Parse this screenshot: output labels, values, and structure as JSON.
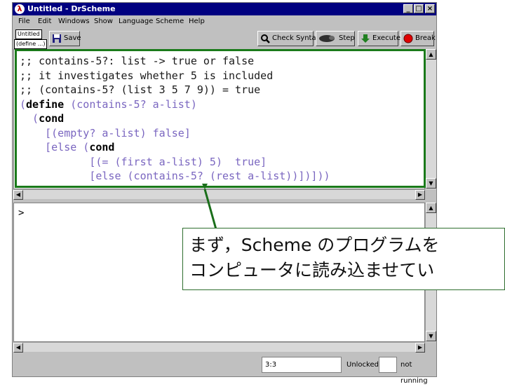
{
  "window": {
    "title": "Untitled - DrScheme",
    "app_icon": "λ",
    "controls": [
      "_",
      "□",
      "×"
    ]
  },
  "menu": {
    "items": [
      "File",
      "Edit",
      "Windows",
      "Show",
      "Language",
      "Scheme",
      "Help"
    ]
  },
  "toolbar": {
    "file_button": "Untitled",
    "define_button": "(define ...)",
    "save_label": "Save",
    "check_syntax_label": "Check Syntax",
    "step_label": "Step",
    "execute_label": "Execute",
    "break_label": "Break"
  },
  "editor": {
    "lines": [
      [
        {
          "t": ";; contains-5?: list -> true or false",
          "c": "comment"
        }
      ],
      [
        {
          "t": ";; it investigates whether 5 is included",
          "c": "comment"
        }
      ],
      [
        {
          "t": ";; (contains-5? (list 3 5 7 9)) = true",
          "c": "comment"
        }
      ],
      [
        {
          "t": "(",
          "c": "def"
        },
        {
          "t": "define",
          "c": "kw"
        },
        {
          "t": " (contains-5? a-list)",
          "c": "def"
        }
      ],
      [
        {
          "t": "  (",
          "c": "def"
        },
        {
          "t": "cond",
          "c": "kw"
        }
      ],
      [
        {
          "t": "    [(empty? a-list) false]",
          "c": "def"
        }
      ],
      [
        {
          "t": "    [else (",
          "c": "def"
        },
        {
          "t": "cond",
          "c": "kw"
        }
      ],
      [
        {
          "t": "           [(= (first a-list) 5)  true]",
          "c": "def"
        }
      ],
      [
        {
          "t": "           [else (contains-5? (rest a-list))])]))",
          "c": "def"
        }
      ]
    ]
  },
  "interactions": {
    "prompt": ">"
  },
  "status": {
    "position": "3:3",
    "lock_state": "Unlocked",
    "run_state": "not running"
  },
  "callout": {
    "line1": "まず，Scheme のプログラムを",
    "line2": "コンピュータに読み込ませてい"
  },
  "colors": {
    "titlebar": "#000080",
    "highlight": "#1a7a1a",
    "code_text": "#7a66c0",
    "break_icon": "#e00000",
    "execute_icon": "#208020"
  }
}
